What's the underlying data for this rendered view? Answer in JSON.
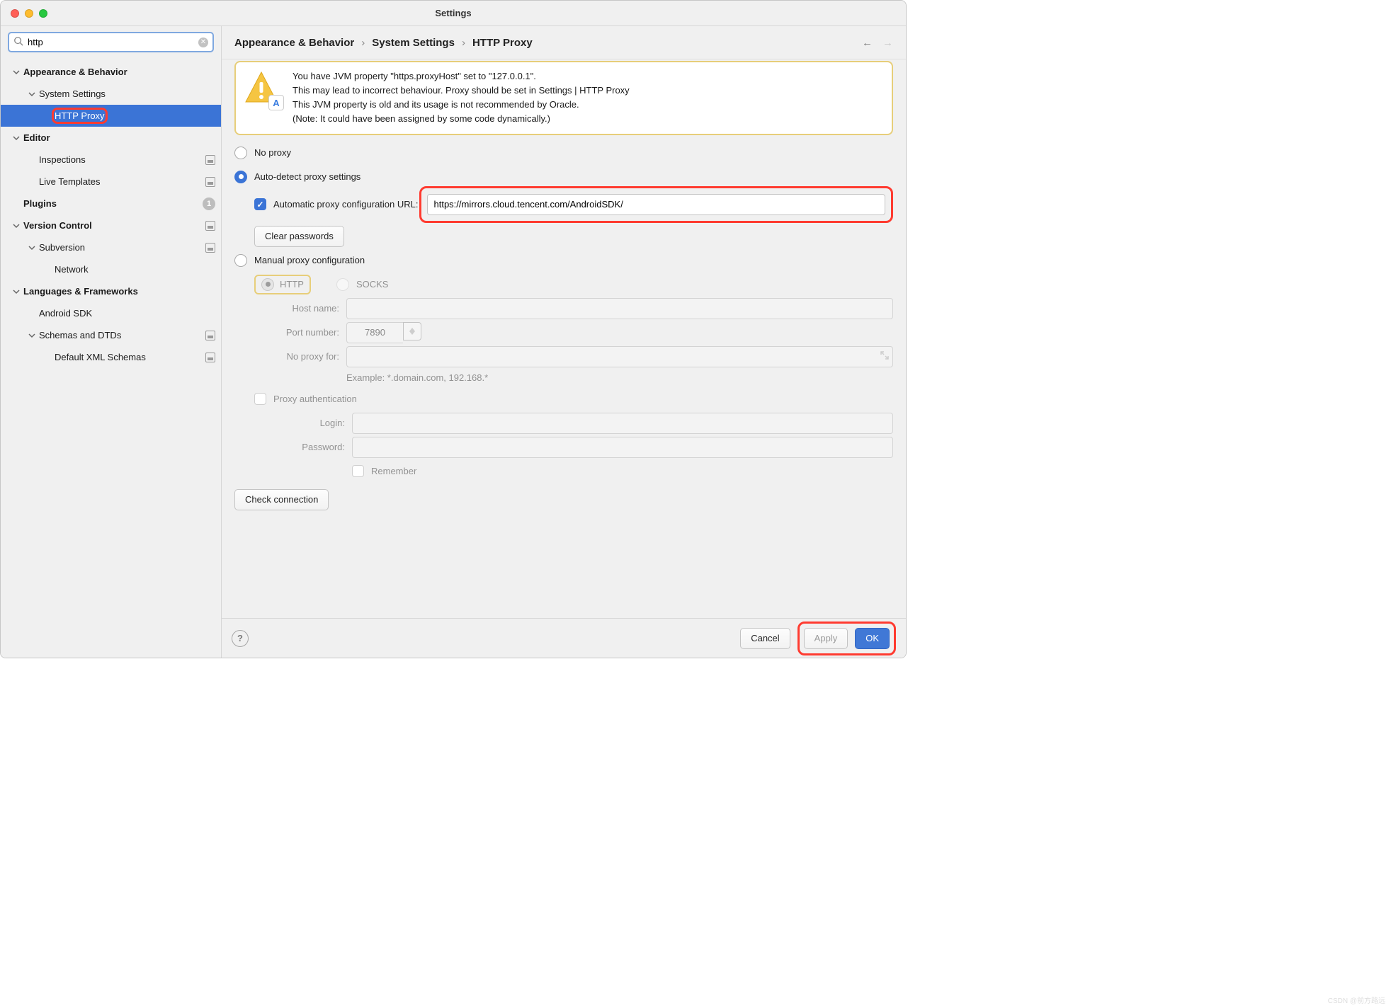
{
  "title": "Settings",
  "search": {
    "value": "http",
    "placeholder": ""
  },
  "tree": [
    {
      "label": "Appearance & Behavior",
      "bold": true,
      "depth": 0,
      "expanded": true,
      "hasChildren": true
    },
    {
      "label": "System Settings",
      "bold": false,
      "depth": 1,
      "expanded": true,
      "hasChildren": true
    },
    {
      "label": "HTTP Proxy",
      "bold": false,
      "depth": 2,
      "selected": true,
      "highlight": true,
      "hasChildren": false
    },
    {
      "label": "Editor",
      "bold": true,
      "depth": 0,
      "expanded": true,
      "hasChildren": true
    },
    {
      "label": "Inspections",
      "bold": false,
      "depth": 1,
      "hasChildren": false,
      "proj": true
    },
    {
      "label": "Live Templates",
      "bold": false,
      "depth": 1,
      "hasChildren": false,
      "proj": true
    },
    {
      "label": "Plugins",
      "bold": true,
      "depth": 0,
      "hasChildren": false,
      "count": "1"
    },
    {
      "label": "Version Control",
      "bold": true,
      "depth": 0,
      "expanded": true,
      "hasChildren": true,
      "proj": true
    },
    {
      "label": "Subversion",
      "bold": false,
      "depth": 1,
      "expanded": true,
      "hasChildren": true,
      "proj": true
    },
    {
      "label": "Network",
      "bold": false,
      "depth": 2,
      "hasChildren": false
    },
    {
      "label": "Languages & Frameworks",
      "bold": true,
      "depth": 0,
      "expanded": true,
      "hasChildren": true
    },
    {
      "label": "Android SDK",
      "bold": false,
      "depth": 1,
      "hasChildren": false
    },
    {
      "label": "Schemas and DTDs",
      "bold": false,
      "depth": 1,
      "expanded": true,
      "hasChildren": true,
      "proj": true
    },
    {
      "label": "Default XML Schemas",
      "bold": false,
      "depth": 2,
      "hasChildren": false,
      "proj": true
    }
  ],
  "breadcrumbs": [
    "Appearance & Behavior",
    "System Settings",
    "HTTP Proxy"
  ],
  "alert": {
    "line1": "You have JVM property \"https.proxyHost\" set to \"127.0.0.1\".",
    "line2": "This may lead to incorrect behaviour. Proxy should be set in Settings | HTTP Proxy",
    "line3": "This JVM property is old and its usage is not recommended by Oracle.",
    "line4": "(Note: It could have been assigned by some code dynamically.)"
  },
  "proxy": {
    "no_proxy_label": "No proxy",
    "autodetect_label": "Auto-detect proxy settings",
    "pac_label": "Automatic proxy configuration URL:",
    "pac_url": "https://mirrors.cloud.tencent.com/AndroidSDK/",
    "clear_passwords": "Clear passwords",
    "manual_label": "Manual proxy configuration",
    "http_label": "HTTP",
    "socks_label": "SOCKS",
    "hostname_label": "Host name:",
    "hostname_value": "",
    "port_label": "Port number:",
    "port_value": "7890",
    "noproxyfor_label": "No proxy for:",
    "noproxyfor_value": "",
    "noproxy_example": "Example: *.domain.com, 192.168.*",
    "proxyauth_label": "Proxy authentication",
    "login_label": "Login:",
    "login_value": "",
    "password_label": "Password:",
    "password_value": "",
    "remember_label": "Remember",
    "check_connection": "Check connection"
  },
  "footer": {
    "cancel": "Cancel",
    "apply": "Apply",
    "ok": "OK"
  },
  "watermark": "CSDN @前方路远"
}
